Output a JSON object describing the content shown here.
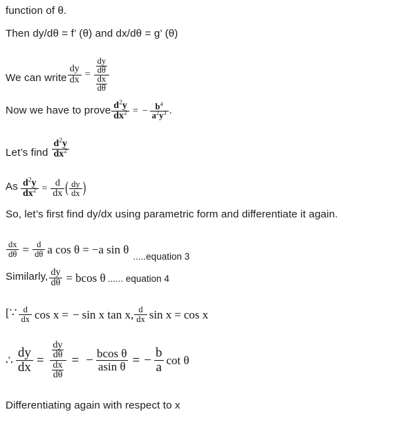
{
  "document": {
    "type": "math-worked-solution",
    "topic": "Second derivative of a parametric curve"
  },
  "lines": {
    "l1_function_of": "function of θ.",
    "l2_then": "Then dy/dθ = f’ (θ) and dx/dθ = g’ (θ)",
    "l3_we_can_write": "We can write",
    "l4_now_we_have_to_prove": "Now we have to prove",
    "l4_period": ".",
    "l5_lets_find": "Let’s find",
    "l6_as": "As",
    "l7_so_lets_first": "So, let’s first find dy/dx using parametric form and differentiate it again.",
    "l8_eq3_tag": ".....equation 3",
    "l9_similarly": "Similarly,",
    "l9_eq4_tag": "...... equation 4",
    "l10_bracket_open": "[∵",
    "l11_differentiating": "Differentiating again with respect to x"
  },
  "equations": {
    "dy_dx_parametric": {
      "label": "dy/dx = (dy/dθ)/(dx/dθ)",
      "lhs_num": "dy",
      "lhs_den": "dx",
      "equals": "=",
      "rhs_num_num": "dy",
      "rhs_num_den": "dθ",
      "rhs_den_num": "dx",
      "rhs_den_den": "dθ"
    },
    "to_prove": {
      "label": "d²y/dx² = − b⁴/(a²y³)",
      "lhs_num_base": "d",
      "lhs_num_sup": "2",
      "lhs_num_var": "y",
      "lhs_den_base": "dx",
      "lhs_den_sup": "2",
      "equals": "=",
      "minus": "−",
      "rhs_num_base": "b",
      "rhs_num_sup": "4",
      "rhs_den_a": "a",
      "rhs_den_a_sup": "2",
      "rhs_den_y": "y",
      "rhs_den_y_sup": "3"
    },
    "second_deriv_symbol": {
      "label": "d²y/dx²",
      "num_base": "d",
      "num_sup": "2",
      "num_var": "y",
      "den_base": "dx",
      "den_sup": "2"
    },
    "as_definition": {
      "label": "d²y/dx² = d/dx (dy/dx)",
      "equals": "=",
      "d_op_num": "d",
      "d_op_den": "dx",
      "paren_open": "(",
      "inner_num": "dy",
      "inner_den": "dx",
      "paren_close": ")"
    },
    "dx_dtheta": {
      "label": "dx/dθ = d/dθ a cos θ = −a sin θ",
      "lhs_num": "dx",
      "lhs_den": "dθ",
      "equals1": "=",
      "op_num": "d",
      "op_den": "dθ",
      "expr1": "a cos θ",
      "equals2": "=",
      "expr2": "−a sin θ"
    },
    "dy_dtheta": {
      "label": "dy/dθ = bcos θ",
      "num": "dy",
      "den": "dθ",
      "equals": "=",
      "rhs": "bcos θ"
    },
    "bracket_identities": {
      "label": "d/dx cos x = − sin x tan x, d/dx sin x = cos x",
      "op1_num": "d",
      "op1_den": "dx",
      "expr1": "cos x",
      "equals1": "=",
      "minus": "−",
      "expr2": "sin x tan x,",
      "op2_num": "d",
      "op2_den": "dx",
      "expr3": "sin x",
      "equals2": "=",
      "expr4": "cos x"
    },
    "final_dy_dx": {
      "label": "∴ dy/dx = (dy/dθ)/(dx/dθ) = − bcosθ/asinθ = − (b/a) cot θ",
      "therefore": "∴",
      "lhs_num": "dy",
      "lhs_den": "dx",
      "equals1": "=",
      "stack_num_num": "dy",
      "stack_num_den": "dθ",
      "stack_den_num": "dx",
      "stack_den_den": "dθ",
      "equals2": "=",
      "minus1": "−",
      "rhs1_num": "bcos θ",
      "rhs1_den": "asin θ",
      "equals3": "=",
      "minus2": "−",
      "rhs2_num": "b",
      "rhs2_den": "a",
      "cot": "cot θ"
    }
  }
}
